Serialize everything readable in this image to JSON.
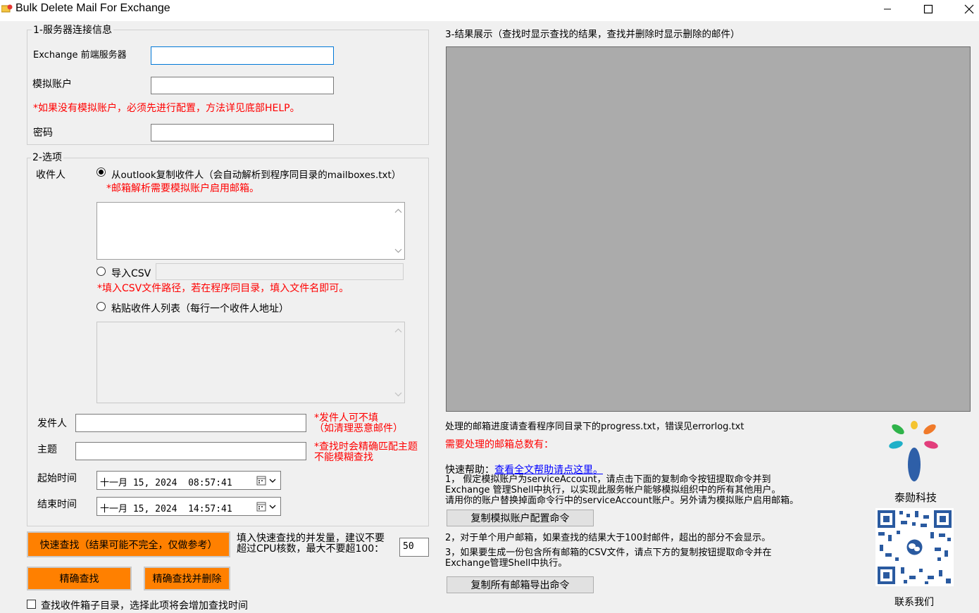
{
  "window": {
    "title": "Bulk Delete Mail For Exchange",
    "minimize_glyph": "—",
    "maximize_glyph": "☐",
    "close_glyph": "✕"
  },
  "server_group": {
    "title": "1-服务器连接信息",
    "frontend_label": "Exchange 前端服务器",
    "frontend_value": "",
    "impersonation_label": "模拟账户",
    "impersonation_value": "",
    "impersonation_note": "*如果没有模拟账户，必须先进行配置，方法详见底部HELP。",
    "password_label": "密码",
    "password_value": ""
  },
  "options_group": {
    "title": "2-选项",
    "recipients_label": "收件人",
    "radio_outlook_label": "从outlook复制收件人（会自动解析到程序同目录的mailboxes.txt）",
    "radio_outlook_note": "*邮箱解析需要模拟账户启用邮箱。",
    "radio_csv_label": "导入CSV",
    "csv_path_value": "",
    "csv_note": "*填入CSV文件路径，若在程序同目录，填入文件名即可。",
    "radio_paste_label": "粘贴收件人列表（每行一个收件人地址）",
    "sender_label": "发件人",
    "sender_value": "",
    "sender_note_line1": "*发件人可不填",
    "sender_note_line2": "（如清理恶意邮件）",
    "subject_label": "主题",
    "subject_value": "",
    "subject_note_line1": "*查找时会精确匹配主题",
    "subject_note_line2": "不能模糊查找",
    "start_label": "起始时间",
    "start_value": "十一月 15, 2024  08:57:41",
    "end_label": "结束时间",
    "end_value": "十一月 15, 2024  14:57:41"
  },
  "actions": {
    "quick_search_label": "快速查找（结果可能不完全，仅做参考）",
    "concurrency_note_line1": "填入快速查找的并发量，建议不要",
    "concurrency_note_line2": "超过CPU核数，最大不要超100：",
    "concurrency_value": "50",
    "exact_search_label": "精确查找",
    "exact_search_delete_label": "精确查找并删除",
    "subfolder_checkbox_label": "查找收件箱子目录，选择此项将会增加查找时间"
  },
  "results": {
    "title": "3-结果展示（查找时显示查找的结果，查找并删除时显示删除的邮件）",
    "progress_note": "处理的邮箱进度请查看程序同目录下的progress.txt，错误见errorlog.txt",
    "total_label": "需要处理的邮箱总数有："
  },
  "help": {
    "quick_help_label": "快速帮助：",
    "quick_help_link": "查看全文帮助请点这里。",
    "item1_line1": "1， 假定模拟账户为serviceAccount，请点击下面的复制命令按钮提取命令并到",
    "item1_line2": "Exchange 管理Shell中执行，以实现此服务帐户能够模拟组织中的所有其他用户。",
    "item1_line3": "请用你的账户替换掉面命令行中的serviceAccount账户。另外请为模拟账户启用邮箱。",
    "copy_impersonation_button": "复制模拟账户配置命令",
    "item2": "2，对于单个用户邮箱，如果查找的结果大于100封邮件，超出的部分不会显示。",
    "item3_line1": "3，如果要生成一份包含所有邮箱的CSV文件，请点下方的复制按钮提取命令并在",
    "item3_line2": "Exchange管理Shell中执行。",
    "copy_export_button": "复制所有邮箱导出命令"
  },
  "brand": {
    "company": "泰勋科技",
    "contact": "联系我们"
  }
}
